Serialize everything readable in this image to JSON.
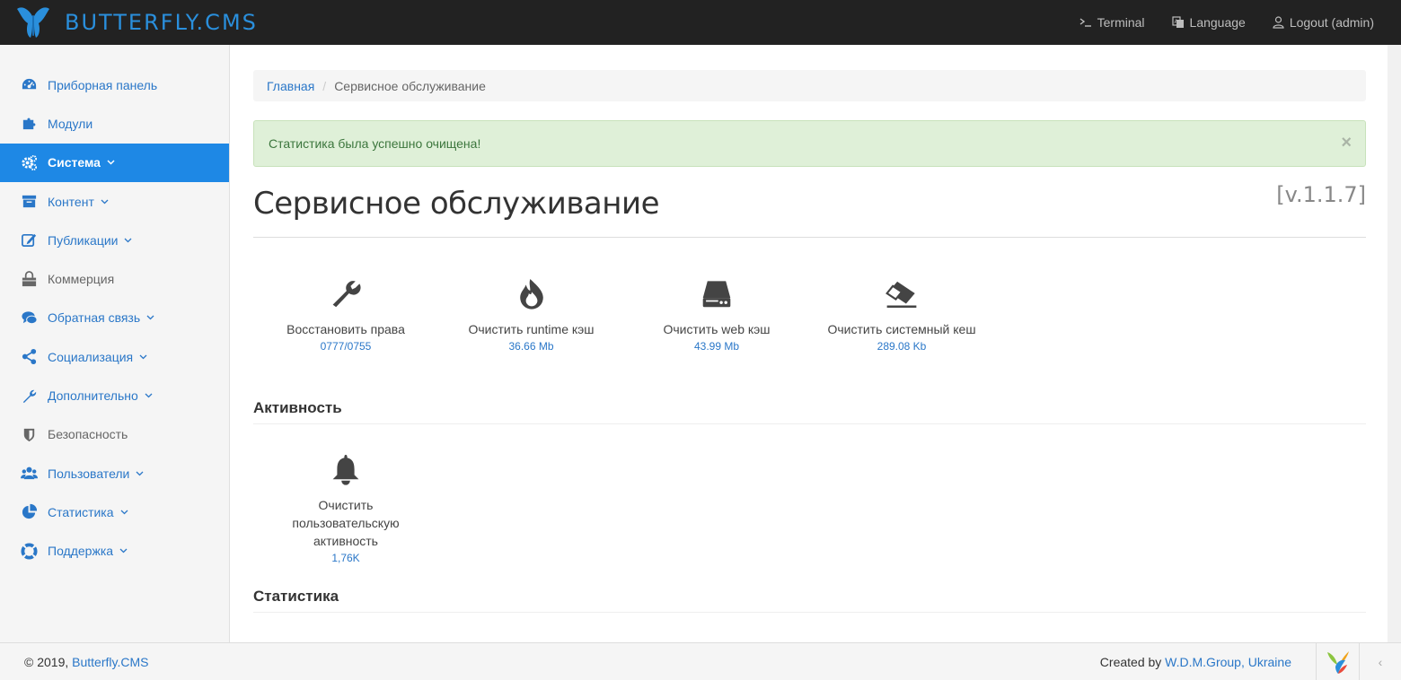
{
  "brand": {
    "name": "BUTTERFLY.CMS",
    "accent": "#2a8fdc"
  },
  "topnav": [
    {
      "icon": "terminal-icon",
      "label": "Terminal"
    },
    {
      "icon": "language-icon",
      "label": "Language"
    },
    {
      "icon": "user-icon",
      "label": "Logout (admin)"
    }
  ],
  "sidebar": {
    "active_color": "#1e88e5",
    "items": [
      {
        "icon": "dashboard-icon",
        "label": "Приборная панель"
      },
      {
        "icon": "puzzle-icon",
        "label": "Модули"
      },
      {
        "icon": "cogs-icon",
        "label": "Система"
      },
      {
        "icon": "archive-icon",
        "label": "Контент"
      },
      {
        "icon": "edit-icon",
        "label": "Публикации"
      },
      {
        "icon": "shopping-bag-icon",
        "label": "Коммерция"
      },
      {
        "icon": "comments-icon",
        "label": "Обратная связь"
      },
      {
        "icon": "share-icon",
        "label": "Социализация"
      },
      {
        "icon": "wrench-icon",
        "label": "Дополнительно"
      },
      {
        "icon": "shield-icon",
        "label": "Безопасность"
      },
      {
        "icon": "users-icon",
        "label": "Пользователи"
      },
      {
        "icon": "pie-chart-icon",
        "label": "Статистика"
      },
      {
        "icon": "life-ring-icon",
        "label": "Поддержка"
      }
    ]
  },
  "breadcrumb": {
    "home": "Главная",
    "separator": "/",
    "current": "Сервисное обслуживание"
  },
  "alert": {
    "text": "Статистика была успешно очищена!",
    "close": "×"
  },
  "page": {
    "title": "Сервисное обслуживание",
    "version": "[v.1.1.7]"
  },
  "tools": [
    {
      "icon": "wrench-icon",
      "label": "Восстановить права",
      "value": "0777/0755"
    },
    {
      "icon": "fire-icon",
      "label": "Очистить runtime кэш",
      "value": "36.66 Mb"
    },
    {
      "icon": "hdd-icon",
      "label": "Очистить web кэш",
      "value": "43.99 Mb"
    },
    {
      "icon": "eraser-icon",
      "label": "Очистить системный кеш",
      "value": "289.08 Kb"
    }
  ],
  "sections": {
    "activity": {
      "title": "Активность",
      "tool": {
        "icon": "bell-icon",
        "label_lines": [
          "Очистить",
          "пользовательскую",
          "активность"
        ],
        "value": "1,76K"
      }
    },
    "statistics": {
      "title": "Статистика"
    }
  },
  "footer": {
    "copy_prefix": "© 2019,",
    "copy_link": "Butterfly.CMS",
    "credit_prefix": "Created by",
    "credit_link": "W.D.M.Group, Ukraine",
    "toggle": "‹"
  }
}
